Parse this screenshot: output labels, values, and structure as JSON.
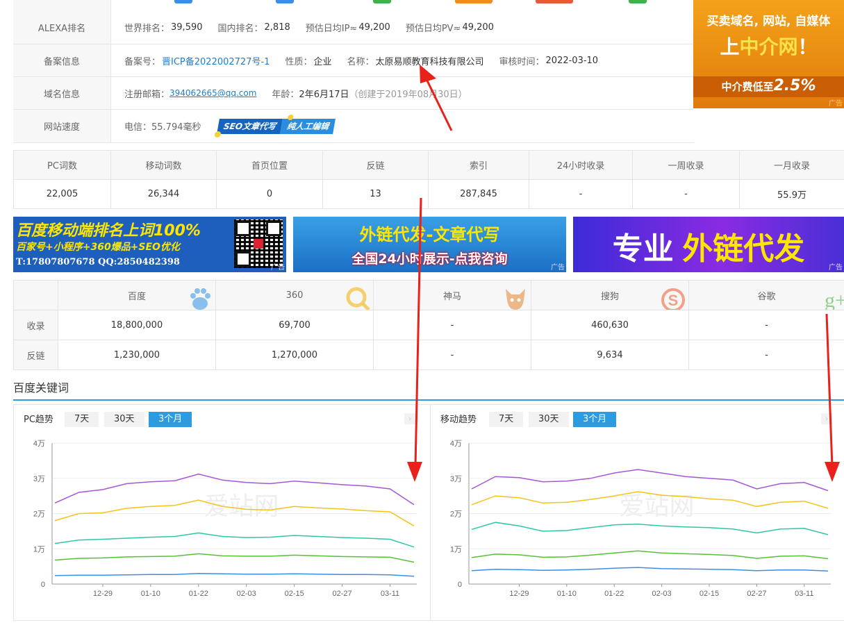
{
  "info": {
    "alexa": {
      "label": "ALEXA排名",
      "world_label": "世界排名：",
      "world": "39,590",
      "domestic_label": "国内排名：",
      "domestic": "2,818",
      "ip_label": "预估日均IP≈",
      "ip": "49,200",
      "pv_label": "预估日均PV≈",
      "pv": "49,200"
    },
    "beian": {
      "label": "备案信息",
      "no_label": "备案号：",
      "no": "晋ICP备2022002727号-1",
      "nature_label": "性质：",
      "nature": "企业",
      "name_label": "名称：",
      "name": "太原易顺教育科技有限公司",
      "review_label": "审核时间：",
      "review": "2022-03-10"
    },
    "domain": {
      "label": "域名信息",
      "email_label": "注册邮箱：",
      "email": "394062665@qq.com",
      "age_label": "年龄：",
      "age": "2年6月17日",
      "created": "（创建于2019年08月30日）"
    },
    "speed": {
      "label": "网站速度",
      "telecom": "电信：55.794毫秒",
      "badge1": "SEO文章代写",
      "badge2": "纯人工编辑"
    }
  },
  "ad_right": {
    "line1": "买卖域名, 网站, 自媒体",
    "line2a": "上",
    "line2b": "中介网",
    "line2c": "！",
    "line3": "中介费低至",
    "line3b": "2.5%",
    "tag": "广告"
  },
  "stats": {
    "headers": [
      "PC词数",
      "移动词数",
      "首页位置",
      "反链",
      "索引",
      "24小时收录",
      "一周收录",
      "一月收录"
    ],
    "values": [
      "22,005",
      "26,344",
      "0",
      "13",
      "287,845",
      "-",
      "-",
      "55.9万"
    ]
  },
  "ads": {
    "ad1_line1": "百度移动端排名上词100%",
    "ad1_line2": "百家号+小程序+360爆品+SEO优化",
    "ad1_line3": "T:17807807678  QQ:2850482398",
    "ad2_line1": "外链代发-文章代写",
    "ad2_line2": "全国24小时展示-点我咨询",
    "ad3_line1": "专业",
    "ad3_line2": "外链代发",
    "tag": "广告"
  },
  "engines": {
    "headers": [
      "",
      "百度",
      "360",
      "神马",
      "搜狗",
      "谷歌"
    ],
    "rows": [
      {
        "label": "收录",
        "values": [
          "18,800,000",
          "69,700",
          "-",
          "460,630",
          "-"
        ]
      },
      {
        "label": "反链",
        "values": [
          "1,230,000",
          "1,270,000",
          "-",
          "9,634",
          "-"
        ]
      }
    ]
  },
  "section_title": "百度关键词",
  "charts": [
    {
      "title": "PC趋势",
      "ranges": [
        "7天",
        "30天",
        "3个月"
      ],
      "active": "3个月",
      "yticks": [
        "0",
        "1万",
        "2万",
        "3万",
        "4万"
      ],
      "xticks": [
        "12-29",
        "01-10",
        "01-22",
        "02-03",
        "02-15",
        "02-27",
        "03-11"
      ],
      "watermark": "爱站网"
    },
    {
      "title": "移动趋势",
      "ranges": [
        "7天",
        "30天",
        "3个月"
      ],
      "active": "3个月",
      "yticks": [
        "0",
        "1万",
        "2万",
        "3万",
        "4万"
      ],
      "xticks": [
        "12-29",
        "01-10",
        "01-22",
        "02-03",
        "02-15",
        "02-27",
        "03-11"
      ],
      "watermark": "爱站网"
    }
  ],
  "chart_data": [
    {
      "type": "line",
      "title": "PC趋势",
      "ylim": [
        0,
        40000
      ],
      "x": [
        "12-17",
        "12-23",
        "12-29",
        "01-04",
        "01-10",
        "01-16",
        "01-22",
        "01-28",
        "02-03",
        "02-09",
        "02-15",
        "02-21",
        "02-27",
        "03-05",
        "03-11",
        "03-15"
      ],
      "series": [
        {
          "color": "#a855d8",
          "values": [
            23000,
            26000,
            26800,
            28500,
            29000,
            29300,
            31200,
            29500,
            28800,
            28500,
            29200,
            28700,
            28200,
            27800,
            27000,
            22500
          ]
        },
        {
          "color": "#f5c21b",
          "values": [
            18000,
            20000,
            20200,
            21500,
            22000,
            22300,
            23800,
            22000,
            21200,
            21000,
            22000,
            21600,
            21300,
            20800,
            20500,
            16500
          ]
        },
        {
          "color": "#2ec7a4",
          "values": [
            11500,
            12500,
            12700,
            13000,
            13300,
            13500,
            14500,
            13500,
            13200,
            13300,
            13800,
            13500,
            13200,
            13000,
            12700,
            10500
          ]
        },
        {
          "color": "#58c034",
          "values": [
            6800,
            7300,
            7400,
            7700,
            7800,
            7900,
            8600,
            8000,
            7900,
            7900,
            8200,
            8000,
            7800,
            7700,
            7600,
            6200
          ]
        },
        {
          "color": "#3a8ee6",
          "values": [
            2400,
            2500,
            2500,
            2600,
            2700,
            2700,
            3000,
            2900,
            2800,
            2800,
            2900,
            2800,
            2700,
            2700,
            2600,
            2200
          ]
        }
      ]
    },
    {
      "type": "line",
      "title": "移动趋势",
      "ylim": [
        0,
        40000
      ],
      "x": [
        "12-17",
        "12-23",
        "12-29",
        "01-04",
        "01-10",
        "01-16",
        "01-22",
        "01-28",
        "02-03",
        "02-09",
        "02-15",
        "02-21",
        "02-27",
        "03-05",
        "03-11",
        "03-15"
      ],
      "series": [
        {
          "color": "#a855d8",
          "values": [
            27000,
            30500,
            30200,
            29000,
            29200,
            30000,
            31500,
            32500,
            31500,
            30500,
            30000,
            29500,
            27000,
            28500,
            28800,
            26500
          ]
        },
        {
          "color": "#f5c21b",
          "values": [
            22500,
            25000,
            24500,
            23000,
            23200,
            24000,
            25000,
            26200,
            25200,
            24800,
            24200,
            23800,
            22000,
            23200,
            23500,
            21500
          ]
        },
        {
          "color": "#2ec7a4",
          "values": [
            15500,
            17500,
            16500,
            15000,
            15200,
            16000,
            16800,
            17000,
            16500,
            16200,
            16000,
            15600,
            14500,
            15600,
            15800,
            14000
          ]
        },
        {
          "color": "#58c034",
          "values": [
            7500,
            8500,
            8300,
            7600,
            7700,
            8200,
            8800,
            9400,
            8800,
            8600,
            8400,
            8100,
            7300,
            7900,
            8000,
            7200
          ]
        },
        {
          "color": "#3a8ee6",
          "values": [
            3800,
            4200,
            4100,
            3900,
            4000,
            4200,
            4500,
            4700,
            4400,
            4300,
            4200,
            4100,
            3800,
            4000,
            4000,
            3700
          ]
        }
      ]
    }
  ]
}
